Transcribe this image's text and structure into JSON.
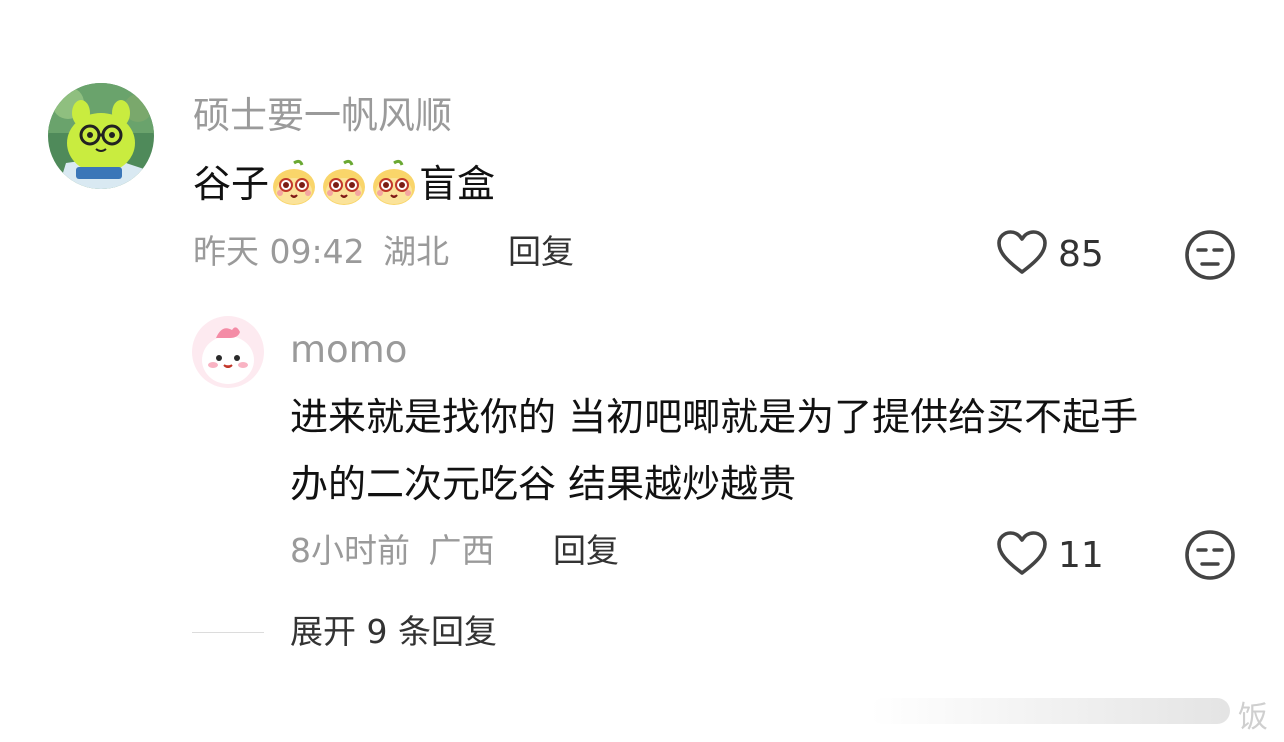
{
  "comments": [
    {
      "user": "硕士要一帆风顺",
      "text_before": "谷子",
      "emoji_icon": "cute-fruit-face-emoji",
      "emoji_count": 3,
      "text_after": "盲盒",
      "time": "昨天 09:42",
      "location": "湖北",
      "reply_label": "回复",
      "likes": "85",
      "reply": {
        "user": "momo",
        "text_line1": "进来就是找你的 当初吧唧就是为了提供给买不起手",
        "text_line2": "办的二次元吃谷 结果越炒越贵",
        "time": "8小时前",
        "location": "广西",
        "reply_label": "回复",
        "likes": "11"
      }
    }
  ],
  "expand_label": "展开 9 条回复",
  "watermark": "饭",
  "colors": {
    "meta": "#9a9a9a",
    "text": "#111111",
    "icon": "#444444"
  }
}
